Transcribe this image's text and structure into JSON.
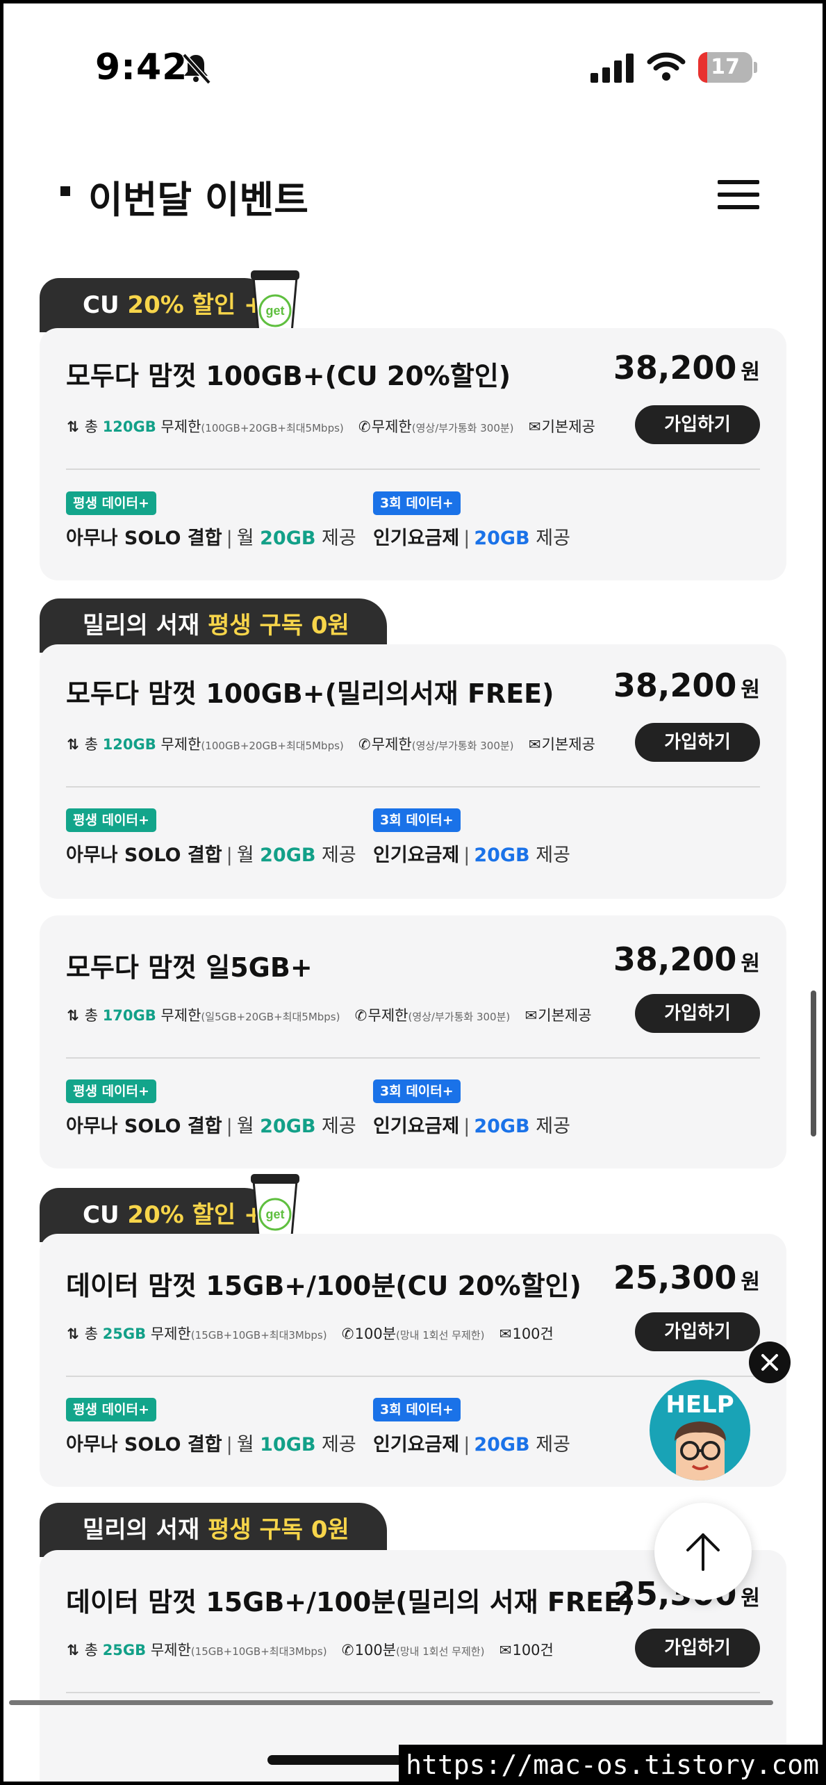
{
  "status": {
    "time": "9:42",
    "battery": "17",
    "battery_level": 0.17
  },
  "header": {
    "title": "이번달 이벤트"
  },
  "cards": [
    {
      "tab": {
        "pre": "CU ",
        "hl": "20% 할인 +",
        "post": ""
      },
      "name": "모두다 맘껏 100GB+(CU 20%할인)",
      "price": "38,200",
      "won": "원",
      "join": "가입하기",
      "spec": {
        "total_pre": "총 ",
        "total": "120GB",
        "total_post": " 무제한",
        "total_note": "(100GB+20GB+최대5Mbps)",
        "call": "무제한",
        "call_note": "(영상/부가통화 300분)",
        "msg": "기본제공"
      },
      "badge1": "평생 데이터+",
      "benefit1": {
        "a": "아무나 SOLO 결합",
        "b": "월 ",
        "v": "20GB",
        "u": " 제공"
      },
      "badge2": "3회 데이터+",
      "benefit2": {
        "a": "인기요금제",
        "v": "20GB",
        "u": " 제공"
      }
    },
    {
      "tab": {
        "pre": "밀리의 서재 ",
        "hl": "평생 구독 0원",
        "post": ""
      },
      "name": "모두다 맘껏 100GB+(밀리의서재 FREE)",
      "price": "38,200",
      "won": "원",
      "join": "가입하기",
      "spec": {
        "total_pre": "총 ",
        "total": "120GB",
        "total_post": " 무제한",
        "total_note": "(100GB+20GB+최대5Mbps)",
        "call": "무제한",
        "call_note": "(영상/부가통화 300분)",
        "msg": "기본제공"
      },
      "badge1": "평생 데이터+",
      "benefit1": {
        "a": "아무나 SOLO 결합",
        "b": "월 ",
        "v": "20GB",
        "u": " 제공"
      },
      "badge2": "3회 데이터+",
      "benefit2": {
        "a": "인기요금제",
        "v": "20GB",
        "u": " 제공"
      }
    },
    {
      "name": "모두다 맘껏 일5GB+",
      "price": "38,200",
      "won": "원",
      "join": "가입하기",
      "spec": {
        "total_pre": "총 ",
        "total": "170GB",
        "total_post": " 무제한",
        "total_note": "(일5GB+20GB+최대5Mbps)",
        "call": "무제한",
        "call_note": "(영상/부가통화 300분)",
        "msg": "기본제공"
      },
      "badge1": "평생 데이터+",
      "benefit1": {
        "a": "아무나 SOLO 결합",
        "b": "월 ",
        "v": "20GB",
        "u": " 제공"
      },
      "badge2": "3회 데이터+",
      "benefit2": {
        "a": "인기요금제",
        "v": "20GB",
        "u": " 제공"
      }
    },
    {
      "tab": {
        "pre": "CU ",
        "hl": "20% 할인 +",
        "post": ""
      },
      "name": "데이터 맘껏 15GB+/100분(CU 20%할인)",
      "price": "25,300",
      "won": "원",
      "join": "가입하기",
      "spec": {
        "total_pre": "총 ",
        "total": "25GB",
        "total_post": " 무제한",
        "total_note": "(15GB+10GB+최대3Mbps)",
        "call": "100분",
        "call_note": "(망내 1회선 무제한)",
        "msg": "100건"
      },
      "badge1": "평생 데이터+",
      "benefit1": {
        "a": "아무나 SOLO 결합",
        "b": "월 ",
        "v": "10GB",
        "u": " 제공"
      },
      "badge2": "3회 데이터+",
      "benefit2": {
        "a": "인기요금제",
        "v": "20GB",
        "u": " 제공"
      }
    },
    {
      "tab": {
        "pre": "밀리의 서재 ",
        "hl": "평생 구독 0원",
        "post": ""
      },
      "name": "데이터 맘껏 15GB+/100분(밀리의 서재 FREE)",
      "price": "25,300",
      "won": "원",
      "join": "가입하기",
      "spec": {
        "total_pre": "총 ",
        "total": "25GB",
        "total_post": " 무제한",
        "total_note": "(15GB+10GB+최대3Mbps)",
        "call": "100분",
        "call_note": "(망내 1회선 무제한)",
        "msg": "100건"
      }
    }
  ],
  "help": {
    "label": "HELP"
  },
  "watermark": "https://mac-os.tistory.com"
}
